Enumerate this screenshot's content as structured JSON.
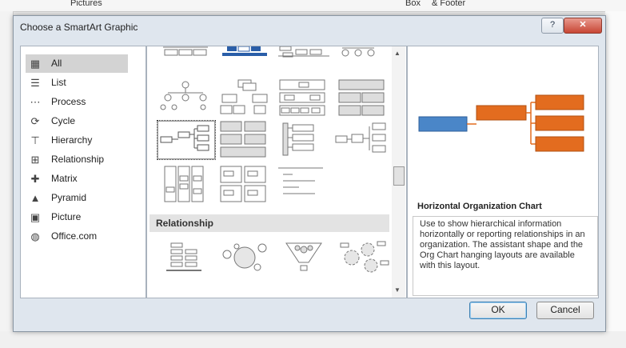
{
  "background": {
    "ribbon_pictures": "Pictures",
    "ribbon_box": "Box",
    "ribbon_footer": "& Footer"
  },
  "dialog": {
    "title": "Choose a SmartArt Graphic",
    "help_label": "?",
    "close_label": "✕"
  },
  "categories": [
    {
      "label": "All",
      "icon": "all-icon",
      "selected": true
    },
    {
      "label": "List",
      "icon": "list-icon"
    },
    {
      "label": "Process",
      "icon": "process-icon"
    },
    {
      "label": "Cycle",
      "icon": "cycle-icon"
    },
    {
      "label": "Hierarchy",
      "icon": "hierarchy-icon"
    },
    {
      "label": "Relationship",
      "icon": "relationship-icon"
    },
    {
      "label": "Matrix",
      "icon": "matrix-icon"
    },
    {
      "label": "Pyramid",
      "icon": "pyramid-icon"
    },
    {
      "label": "Picture",
      "icon": "picture-icon"
    },
    {
      "label": "Office.com",
      "icon": "globe-icon"
    }
  ],
  "gallery": {
    "section_relationship": "Relationship"
  },
  "preview": {
    "title": "Horizontal Organization Chart",
    "description": "Use to show hierarchical information horizontally or reporting relationships in an organization. The assistant shape and the Org Chart hanging layouts are available with this layout.",
    "colors": {
      "blue": "#4a86c8",
      "orange": "#e36c1f"
    }
  },
  "buttons": {
    "ok": "OK",
    "cancel": "Cancel"
  }
}
